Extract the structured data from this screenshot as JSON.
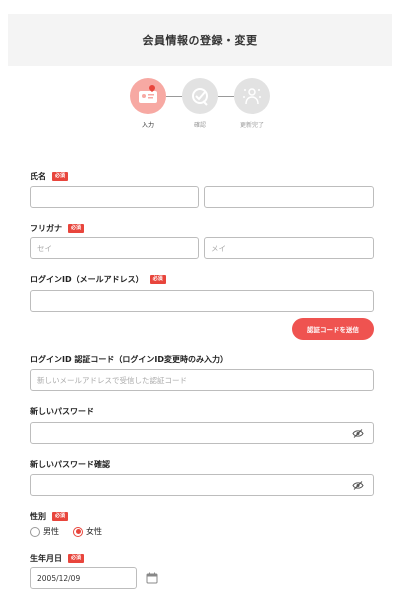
{
  "header": {
    "title": "会員情報の登録・変更"
  },
  "steps": [
    {
      "label": "入力",
      "state": "active",
      "icon": "profile-card-icon"
    },
    {
      "label": "確認",
      "state": "inactive",
      "icon": "checkmark-icon"
    },
    {
      "label": "更新完了",
      "state": "inactive",
      "icon": "celebration-icon"
    }
  ],
  "required_badge": "必須",
  "form": {
    "name": {
      "label": "氏名",
      "last_value": "",
      "first_value": ""
    },
    "furigana": {
      "label": "フリガナ",
      "last_placeholder": "セイ",
      "first_placeholder": "メイ"
    },
    "login_id": {
      "label": "ログインID（メールアドレス）",
      "value": ""
    },
    "send_code_button": "認証コードを送信",
    "verify_code": {
      "label": "ログインID 認証コード（ログインID変更時のみ入力）",
      "placeholder": "新しいメールアドレスで受信した認証コード"
    },
    "new_password": {
      "label": "新しいパスワード",
      "value": ""
    },
    "confirm_password": {
      "label": "新しいパスワード確認",
      "value": ""
    },
    "gender": {
      "label": "性別",
      "options": [
        "男性",
        "女性"
      ],
      "selected": "女性"
    },
    "birthday": {
      "label": "生年月日",
      "value": "2005/12/09"
    }
  },
  "colors": {
    "accent": "#e8453c",
    "button": "#ef5350",
    "step_active": "#f7a9a3",
    "step_inactive": "#e2e2e2"
  }
}
